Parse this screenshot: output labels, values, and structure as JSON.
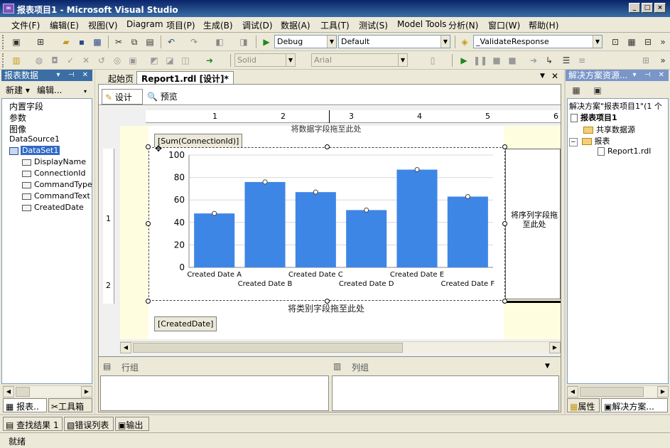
{
  "window": {
    "title": "报表项目1 - Microsoft Visual Studio",
    "app_icon": "visual-studio-icon",
    "buttons": [
      "_",
      "□",
      "×"
    ]
  },
  "menu": [
    "文件(F)",
    "编辑(E)",
    "视图(V)",
    "Diagram",
    "项目(P)",
    "生成(B)",
    "调试(D)",
    "数据(A)",
    "工具(T)",
    "测试(S)",
    "Model Tools",
    "分析(N)",
    "窗口(W)",
    "帮助(H)"
  ],
  "toolbar1": {
    "config": "Debug",
    "platform": "Default",
    "find": "_ValidateResponse"
  },
  "toolbar2": {
    "line_style": "Solid",
    "font": "Arial"
  },
  "report_data_panel": {
    "title": "报表数据",
    "new_label": "新建",
    "edit_label": "编辑...",
    "items": [
      "内置字段",
      "参数",
      "图像",
      "DataSource1"
    ],
    "dataset": "DataSet1",
    "fields": [
      "DisplayName",
      "ConnectionId",
      "CommandType",
      "CommandText",
      "CreatedDate"
    ],
    "tabs": [
      "报表..",
      "工具箱"
    ]
  },
  "doc_tabs": [
    "起始页",
    "Report1.rdl [设计]*"
  ],
  "view_tabs": [
    "设计",
    "预览"
  ],
  "ruler_numbers": [
    "1",
    "2",
    "3",
    "4",
    "5",
    "6"
  ],
  "vertical_ruler": [
    "1",
    "2"
  ],
  "design": {
    "top_drop_text": "将数据字段拖至此处",
    "value_field": "[Sum(ConnectionId)]",
    "series_drop": "将序列字段拖至此处",
    "category_drop": "将类别字段拖至此处",
    "category_field": "[CreatedDate]"
  },
  "grouping": {
    "row_label": "行组",
    "col_label": "列组"
  },
  "solution_panel": {
    "title": "解决方案资源...",
    "solution_line": "解决方案\"报表项目1\"(1 个",
    "project": "报表项目1",
    "folders": [
      "共享数据源",
      "报表"
    ],
    "report_file": "Report1.rdl",
    "tabs": [
      "属性",
      "解决方案..."
    ]
  },
  "output_tabs": [
    "查找结果 1",
    "错误列表",
    "输出"
  ],
  "status": "就绪",
  "chart_data": {
    "type": "bar",
    "categories": [
      "Created Date A",
      "Created Date B",
      "Created Date C",
      "Created Date D",
      "Created Date E",
      "Created Date F"
    ],
    "values": [
      48,
      76,
      67,
      51,
      87,
      63
    ],
    "ylim": [
      0,
      100
    ],
    "yticks": [
      0,
      20,
      40,
      60,
      80,
      100
    ],
    "grid": true,
    "color": "#3e86e6"
  }
}
